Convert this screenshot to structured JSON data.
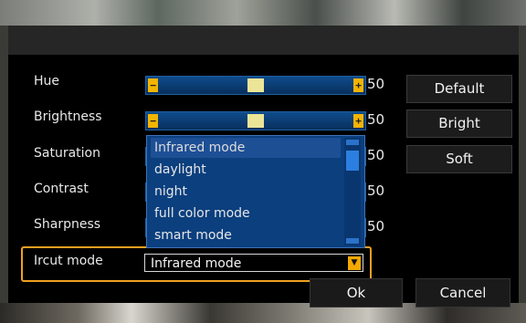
{
  "settings": [
    {
      "label": "Hue",
      "value": "50",
      "level": 50
    },
    {
      "label": "Brightness",
      "value": "50",
      "level": 50
    },
    {
      "label": "Saturation",
      "value": "50",
      "level": 50
    },
    {
      "label": "Contrast",
      "value": "50",
      "level": 50
    },
    {
      "label": "Sharpness",
      "value": "50",
      "level": 50
    }
  ],
  "ircut": {
    "label": "Ircut mode",
    "selected": "Infrared mode",
    "options": [
      "Infrared mode",
      "daylight",
      "night",
      "full color mode",
      "smart mode"
    ]
  },
  "side_buttons": {
    "default": "Default",
    "bright": "Bright",
    "soft": "Soft"
  },
  "footer": {
    "ok": "Ok",
    "cancel": "Cancel"
  },
  "slider_icons": {
    "minus": "−",
    "plus": "+"
  },
  "colors": {
    "accent": "#f0a020",
    "slider": "#0f4c8c",
    "thumb": "#ece598"
  }
}
